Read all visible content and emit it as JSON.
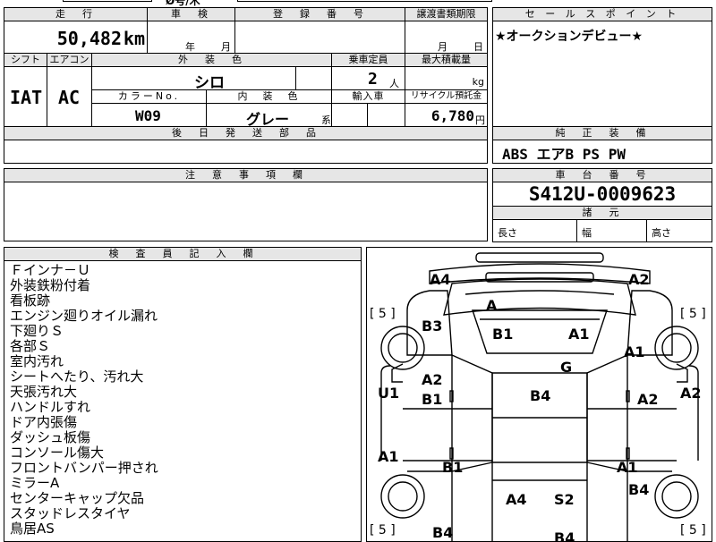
{
  "top_fragments": {
    "left": "Ø号/木",
    "right": "////"
  },
  "main_table": {
    "headers": {
      "mileage": "走　行",
      "inspection": "車　検",
      "registration": "登　録　番　号",
      "transfer_deadline": "譲渡書類期限",
      "shift": "シフト",
      "aircon": "エアコン",
      "exterior_color": "外　装　色",
      "capacity": "乗車定員",
      "max_load": "最大積載量",
      "color_no": "カラーNo.",
      "interior_color": "内　装　色",
      "import": "輸入車",
      "recycle_fee": "リサイクル預託金",
      "later_parts": "後　日　発　送　部　品"
    },
    "values": {
      "mileage": "50,482",
      "mileage_unit": "km",
      "year_unit": "年",
      "month_unit": "月",
      "deadline_month": "月",
      "deadline_day": "日",
      "shift": "IAT",
      "aircon": "AC",
      "exterior_color": "シロ",
      "capacity": "2",
      "capacity_unit": "人",
      "load_unit": "kg",
      "color_no": "W09",
      "interior_color": "グレー",
      "interior_suffix": "系",
      "recycle_fee": "6,780",
      "recycle_unit": "円"
    }
  },
  "sales_point": {
    "header": "セ ー ル ス ポ イ ン ト",
    "text": "★オークションデビュー★"
  },
  "standard_equipment": {
    "header": "純　正　装　備",
    "text": "ABS エアB PS PW"
  },
  "notes": {
    "header": "注　意　事　項　欄"
  },
  "chassis": {
    "header": "車　台　番　号",
    "number": "S412U-0009623"
  },
  "specs": {
    "header": "諸　元",
    "length": "長さ",
    "width": "幅",
    "height": "高さ"
  },
  "inspector": {
    "header": "検　査　員　記　入　欄",
    "lines": [
      "Ｆインナ－Ｕ",
      "外装鉄粉付着",
      "看板跡",
      "エンジン廻りオイル漏れ",
      "下廻りＳ",
      "各部Ｓ",
      "室内汚れ",
      "シートへたり、汚れ大",
      "天張汚れ大",
      "ハンドルすれ",
      "ドア内張傷",
      "ダッシュ板傷",
      "コンソール傷大",
      "フロントバンパー押され",
      "ミラーA",
      "センターキャップ欠品",
      "スタッドレスタイヤ",
      "鳥居AS"
    ]
  },
  "diagram": {
    "tire_depth": "[ 5 ]",
    "labels": {
      "a4_top": "A4",
      "a2_top": "A2",
      "a_front": "A",
      "b3": "B3",
      "b1_hood_l": "B1",
      "a1_hood_r": "A1",
      "a1_right_fender": "A1",
      "g_windshield": "G",
      "a2_left": "A2",
      "b1_left": "B1",
      "b4_roof": "B4",
      "a2_right": "A2",
      "a2_right_side": "A2",
      "u1_left": "U1",
      "a1_left_low": "A1",
      "b1_bottom": "B1",
      "a1_bottom": "A1",
      "b4_right": "B4",
      "a4_rear": "A4",
      "s2_rear": "S2",
      "b4_bottom_left": "B4",
      "b4_bottom_mid": "B4"
    }
  }
}
